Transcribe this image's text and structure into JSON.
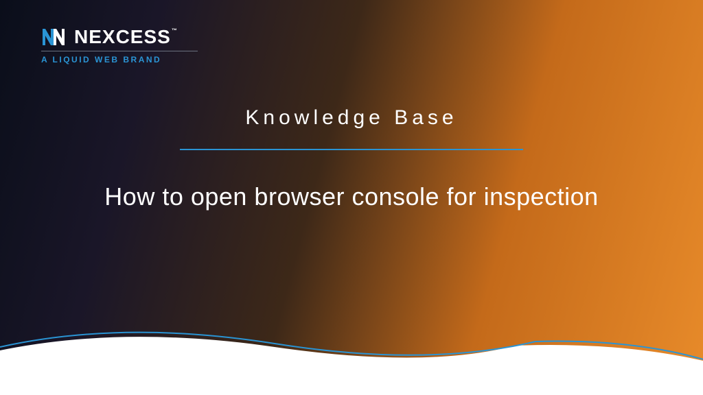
{
  "logo": {
    "brand": "NEXCESS",
    "tagline": "A LIQUID WEB BRAND",
    "trademark": "™"
  },
  "content": {
    "category": "Knowledge Base",
    "title": "How to open browser console for inspection"
  },
  "colors": {
    "accent": "#2a94d4",
    "text": "#ffffff"
  }
}
